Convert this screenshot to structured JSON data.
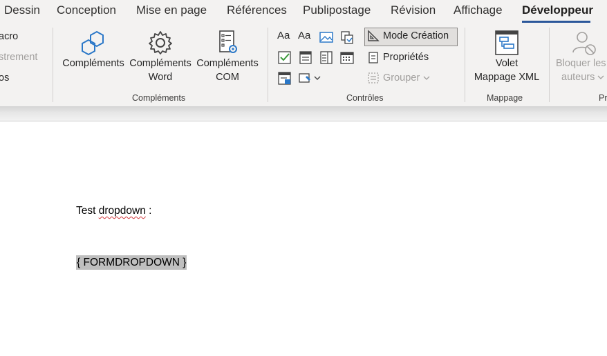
{
  "tabs": [
    {
      "label": "Dessin",
      "active": false
    },
    {
      "label": "Conception",
      "active": false
    },
    {
      "label": "Mise en page",
      "active": false
    },
    {
      "label": "Références",
      "active": false
    },
    {
      "label": "Publipostage",
      "active": false
    },
    {
      "label": "Révision",
      "active": false
    },
    {
      "label": "Affichage",
      "active": false
    },
    {
      "label": "Développeur",
      "active": true
    }
  ],
  "code_group": {
    "lines": [
      {
        "label": "acro",
        "disabled": false
      },
      {
        "label": "strement",
        "disabled": true
      },
      {
        "label": "os",
        "disabled": false
      }
    ]
  },
  "addins_group": {
    "label": "Compléments",
    "buttons": [
      {
        "line1": "Compléments",
        "line2": "",
        "icon": "hexagons-icon"
      },
      {
        "line1": "Compléments",
        "line2": "Word",
        "icon": "gear-icon"
      },
      {
        "line1": "Compléments",
        "line2": "COM",
        "icon": "com-addin-icon"
      }
    ]
  },
  "controls_group": {
    "label": "Contrôles",
    "mode_creation": "Mode Création",
    "properties": "Propriétés",
    "group_button": "Grouper",
    "font_sample": "Aa"
  },
  "mapping_group": {
    "label": "Mappage",
    "button_line1": "Volet",
    "button_line2": "Mappage XML"
  },
  "protect_group": {
    "label": "Pr",
    "button_line1": "Bloquer les",
    "button_line2": "auteurs"
  },
  "document": {
    "line1_prefix": "Test ",
    "line1_word": "dropdown",
    "line1_suffix": " :",
    "field_code": "{ FORMDROPDOWN }"
  },
  "colors": {
    "accent": "#2b579a",
    "ribbon_bg": "#f3f2f1",
    "field_shade": "#bfbfbf"
  }
}
